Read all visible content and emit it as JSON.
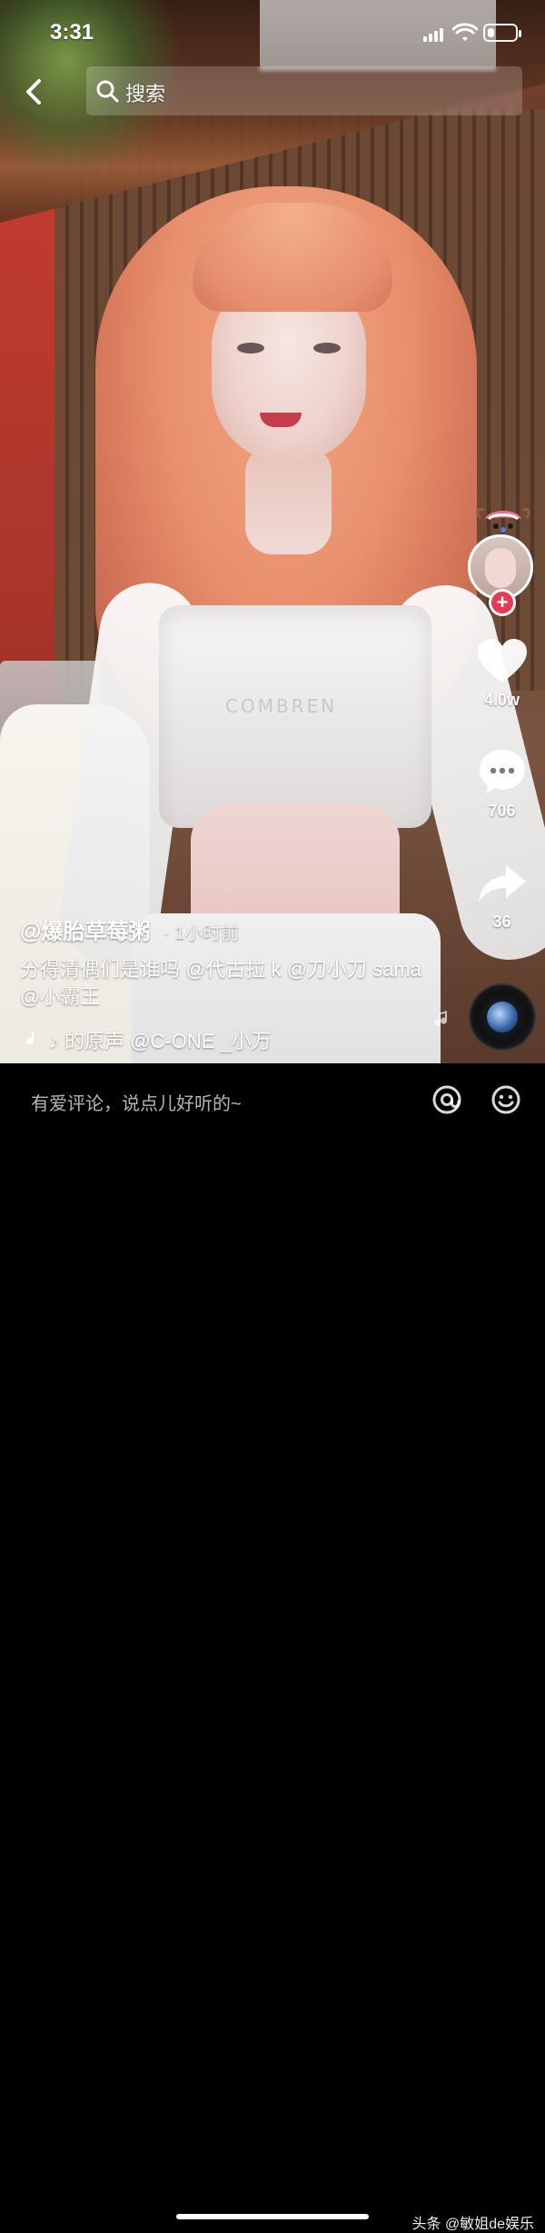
{
  "status_bar": {
    "time": "3:31",
    "battery_level": 0.25
  },
  "search": {
    "placeholder": "搜索"
  },
  "video": {
    "shirt_print": "COMBREN"
  },
  "rail": {
    "likes": "4.0w",
    "comments": "706",
    "shares": "36"
  },
  "post": {
    "author": "@爆胎草莓粥",
    "time_ago": "· 1小时前",
    "caption": "分得清偶们是谁吗 @代古拉 k @刀小刀 sama @小霸王",
    "music": "♪ 的原声    @C-ONE _小万"
  },
  "comment_bar": {
    "placeholder": "有爱评论，说点儿好听的~"
  },
  "watermark": {
    "text": "头条 @敏姐de娱乐"
  },
  "icons": {
    "back": "back-icon",
    "search": "search-icon",
    "like": "heart-icon",
    "comment": "comment-icon",
    "share": "share-icon",
    "at": "at-icon",
    "emoji": "emoji-icon",
    "music_note": "music-note-icon"
  },
  "colors": {
    "follow_plus": "#e63b57"
  }
}
